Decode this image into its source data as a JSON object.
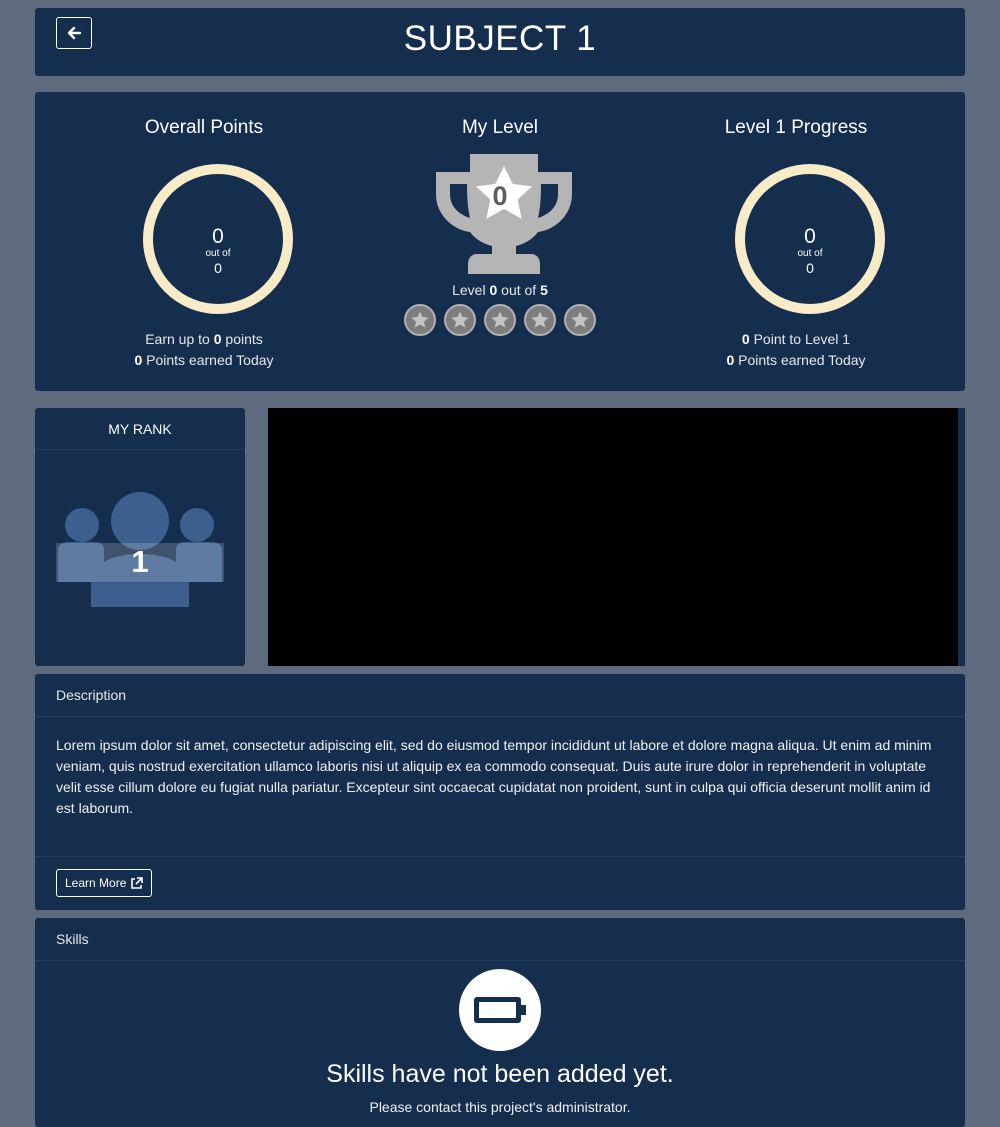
{
  "header": {
    "title": "SUBJECT 1",
    "back_icon": "arrow-left-icon"
  },
  "stats": {
    "overall": {
      "title": "Overall Points",
      "value": "0",
      "out_of_label": "out of",
      "total": "0",
      "progress_fraction": 0,
      "earn_prefix": "Earn up to",
      "earn_value": "0",
      "earn_suffix": "points",
      "today_value": "0",
      "today_label": "Points earned Today"
    },
    "level": {
      "title": "My Level",
      "trophy_icon": "trophy-icon",
      "value": "0",
      "level_prefix": "Level",
      "level_value": "0",
      "out_of_label": "out of",
      "level_max": "5",
      "stars_filled": 0,
      "stars_total": 5
    },
    "progress": {
      "title": "Level 1 Progress",
      "value": "0",
      "out_of_label": "out of",
      "total": "0",
      "progress_fraction": 0,
      "points_to_value": "0",
      "points_to_label": "Point to Level 1",
      "today_value": "0",
      "today_label": "Points earned Today"
    }
  },
  "rank": {
    "title": "MY RANK",
    "icon": "users-icon",
    "value": "1"
  },
  "description": {
    "title": "Description",
    "body": "Lorem ipsum dolor sit amet, consectetur adipiscing elit, sed do eiusmod tempor incididunt ut labore et dolore magna aliqua. Ut enim ad minim veniam, quis nostrud exercitation ullamco laboris nisi ut aliquip ex ea commodo consequat. Duis aute irure dolor in reprehenderit in voluptate velit esse cillum dolore eu fugiat nulla pariatur. Excepteur sint occaecat cupidatat non proident, sunt in culpa qui officia deserunt mollit anim id est laborum.",
    "learn_more_label": "Learn More",
    "learn_more_icon": "external-link-icon"
  },
  "skills": {
    "title": "Skills",
    "empty_icon": "battery-empty-icon",
    "empty_title": "Skills have not been added yet.",
    "empty_subtitle": "Please contact this project's administrator."
  },
  "colors": {
    "background": "#5e6a7e",
    "panel": "#152e4e",
    "ring": "#f7ebc8",
    "trophy": "#b5b5b5"
  }
}
